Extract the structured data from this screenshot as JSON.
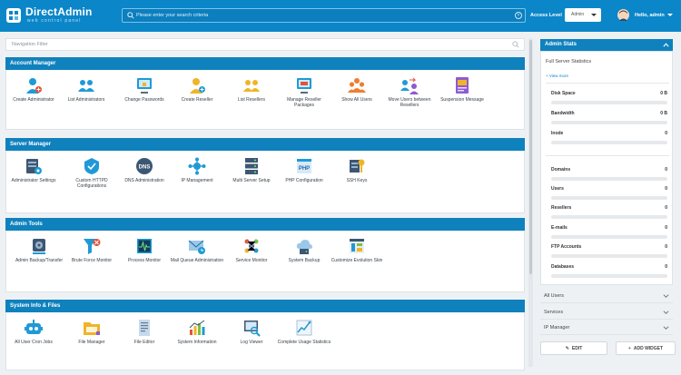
{
  "header": {
    "logo_title": "DirectAdmin",
    "logo_subtitle": "web control panel",
    "search_placeholder": "Please enter your search criteria",
    "access_level_label": "Access Level",
    "access_level_value": "Admin",
    "greeting": "Hello, admin",
    "brand_color": "#0b86c8"
  },
  "nav_filter": {
    "placeholder": "Navigation Filter"
  },
  "sections": [
    {
      "title": "Account Manager",
      "items": [
        {
          "label": "Create Administrator",
          "icon": "create-admin-icon"
        },
        {
          "label": "List Administrators",
          "icon": "list-admins-icon"
        },
        {
          "label": "Change Passwords",
          "icon": "change-passwords-icon"
        },
        {
          "label": "Create Reseller",
          "icon": "create-reseller-icon"
        },
        {
          "label": "List Resellers",
          "icon": "list-resellers-icon"
        },
        {
          "label": "Manage Reseller Packages",
          "icon": "reseller-packages-icon"
        },
        {
          "label": "Show All Users",
          "icon": "all-users-icon"
        },
        {
          "label": "Move Users between Resellers",
          "icon": "move-users-icon"
        },
        {
          "label": "Suspension Message",
          "icon": "suspension-message-icon"
        }
      ]
    },
    {
      "title": "Server Manager",
      "items": [
        {
          "label": "Administrator Settings",
          "icon": "admin-settings-icon"
        },
        {
          "label": "Custom HTTPD Configurations",
          "icon": "httpd-config-icon"
        },
        {
          "label": "DNS Administration",
          "icon": "dns-icon"
        },
        {
          "label": "IP Management",
          "icon": "ip-management-icon"
        },
        {
          "label": "Multi Server Setup",
          "icon": "multi-server-icon"
        },
        {
          "label": "PHP Configuration",
          "icon": "php-config-icon"
        },
        {
          "label": "SSH Keys",
          "icon": "ssh-keys-icon"
        }
      ]
    },
    {
      "title": "Admin Tools",
      "items": [
        {
          "label": "Admin Backup/Transfer",
          "icon": "backup-transfer-icon"
        },
        {
          "label": "Brute Force Monitor",
          "icon": "brute-force-icon"
        },
        {
          "label": "Process Monitor",
          "icon": "process-monitor-icon"
        },
        {
          "label": "Mail Queue Administration",
          "icon": "mail-queue-icon"
        },
        {
          "label": "Service Monitor",
          "icon": "service-monitor-icon"
        },
        {
          "label": "System Backup",
          "icon": "system-backup-icon"
        },
        {
          "label": "Customize Evolution Skin",
          "icon": "customize-skin-icon"
        }
      ]
    },
    {
      "title": "System Info & Files",
      "items": [
        {
          "label": "All User Cron Jobs",
          "icon": "cron-jobs-icon"
        },
        {
          "label": "File Manager",
          "icon": "file-manager-icon"
        },
        {
          "label": "File Editor",
          "icon": "file-editor-icon"
        },
        {
          "label": "System Information",
          "icon": "system-info-icon"
        },
        {
          "label": "Log Viewer",
          "icon": "log-viewer-icon"
        },
        {
          "label": "Complete Usage Statistics",
          "icon": "usage-stats-icon"
        }
      ]
    }
  ],
  "admin_stats": {
    "title": "Admin Stats",
    "full_stats": "Full Server Statistics",
    "view_more": "+ View more",
    "stats_group1": [
      {
        "name": "Disk Space",
        "value": "0 B"
      },
      {
        "name": "Bandwidth",
        "value": "0 B"
      },
      {
        "name": "Inode",
        "value": "0"
      }
    ],
    "stats_group2": [
      {
        "name": "Domains",
        "value": "0"
      },
      {
        "name": "Users",
        "value": "0"
      },
      {
        "name": "Resellers",
        "value": "0"
      },
      {
        "name": "E-mails",
        "value": "0"
      },
      {
        "name": "FTP Accounts",
        "value": "0"
      },
      {
        "name": "Databases",
        "value": "0"
      }
    ]
  },
  "right_panels": [
    "All Users",
    "Services",
    "IP Manager"
  ],
  "buttons": {
    "edit": "EDIT",
    "add_widget": "ADD WIDGET"
  }
}
